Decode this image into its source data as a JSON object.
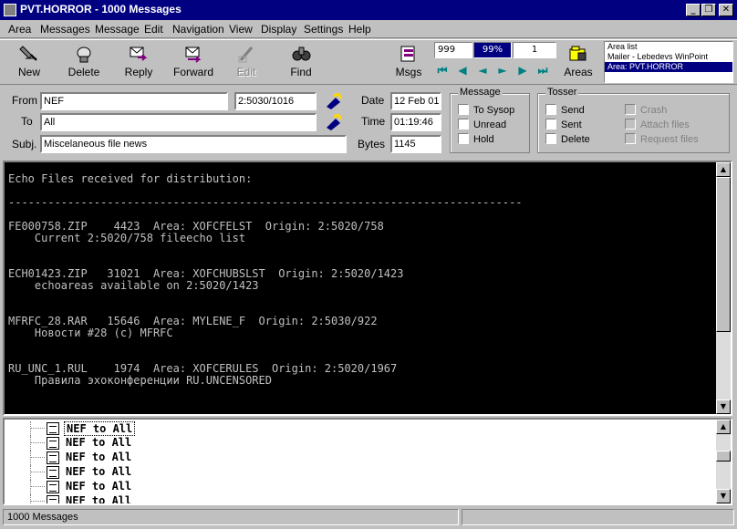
{
  "window": {
    "title": "PVT.HORROR - 1000 Messages"
  },
  "menu": [
    "Area",
    "Messages",
    "Message",
    "Edit",
    "Navigation",
    "View",
    "Display",
    "Settings",
    "Help"
  ],
  "toolbar": {
    "new": "New",
    "delete": "Delete",
    "reply": "Reply",
    "forward": "Forward",
    "edit": "Edit",
    "find": "Find",
    "msgs": "Msgs",
    "areas": "Areas"
  },
  "counters": {
    "total": "999",
    "percent": "99%",
    "current": "1"
  },
  "area_list": [
    "Area list",
    "Mailer - Lebedevs WinPoint",
    "Area: PVT.HORROR"
  ],
  "header": {
    "from_label": "From",
    "from_value": "NEF",
    "from_addr": "2:5030/1016",
    "to_label": "To",
    "to_value": "All",
    "subj_label": "Subj.",
    "subj_value": "Miscelaneous file news",
    "date_label": "Date",
    "date_value": "12 Feb 01",
    "time_label": "Time",
    "time_value": "01:19:46",
    "bytes_label": "Bytes",
    "bytes_value": "1145"
  },
  "message_group": {
    "title": "Message",
    "to_sysop": "To Sysop",
    "unread": "Unread",
    "hold": "Hold"
  },
  "tosser_group": {
    "title": "Tosser",
    "send": "Send",
    "sent": "Sent",
    "delete": "Delete",
    "crash": "Crash",
    "attach": "Attach files",
    "request": "Request files"
  },
  "body_lines": [
    "Echo Files received for distribution:",
    "",
    "------------------------------------------------------------------------------",
    "",
    "FE000758.ZIP    4423  Area: XOFCFELST  Origin: 2:5020/758",
    "    Current 2:5020/758 fileecho list",
    "",
    "",
    "ECH01423.ZIP   31021  Area: XOFCHUBSLST  Origin: 2:5020/1423",
    "    echoareas available on 2:5020/1423",
    "",
    "",
    "MFRFC_28.RAR   15646  Area: MYLENE_F  Origin: 2:5030/922",
    "    Новости #28 (c) MFRFC",
    "",
    "",
    "RU_UNC_1.RUL    1974  Area: XOFCERULES  Origin: 2:5020/1967",
    "    Правила эхоконференции RU.UNCENSORED"
  ],
  "list_rows": [
    "NEF to All",
    "NEF to All",
    "NEF to All",
    "NEF to All",
    "NEF to All",
    "NEF to All"
  ],
  "status": {
    "text": "1000 Messages"
  }
}
